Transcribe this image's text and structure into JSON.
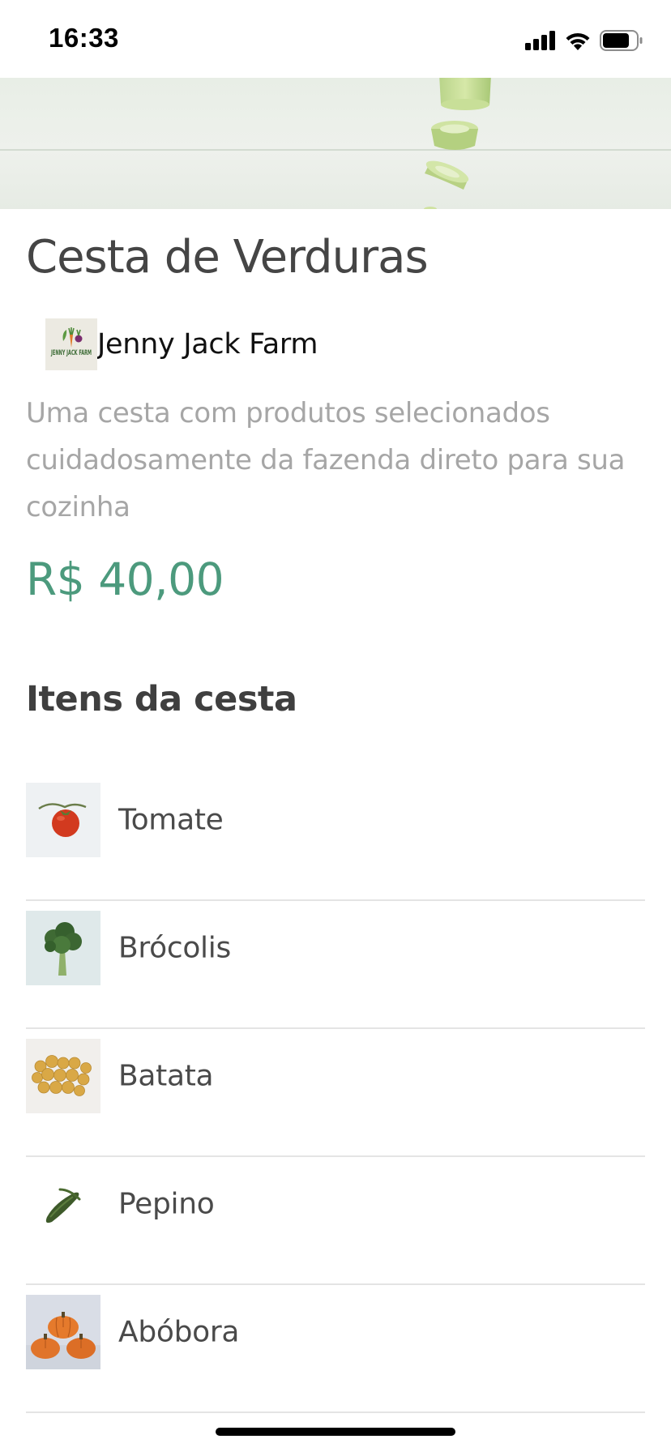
{
  "status_bar": {
    "time": "16:33"
  },
  "product": {
    "title": "Cesta de Verduras",
    "farm_name": "Jenny Jack Farm",
    "farm_logo_text": "JENNY JACK FARM",
    "description": "Uma cesta com produtos selecionados cuidadosamente da fazenda direto para sua cozinha",
    "price": "R$ 40,00"
  },
  "basket": {
    "section_title": "Itens da cesta",
    "items": [
      {
        "label": "Tomate",
        "thumb": "tomato-photo"
      },
      {
        "label": "Brócolis",
        "thumb": "broccoli-photo"
      },
      {
        "label": "Batata",
        "thumb": "potato-photo"
      },
      {
        "label": "Pepino",
        "thumb": "cucumber-photo"
      },
      {
        "label": "Abóbora",
        "thumb": "pumpkin-photo"
      }
    ]
  },
  "colors": {
    "price": "#4c9a7d",
    "title": "#454545",
    "description": "#a6a6a6"
  }
}
